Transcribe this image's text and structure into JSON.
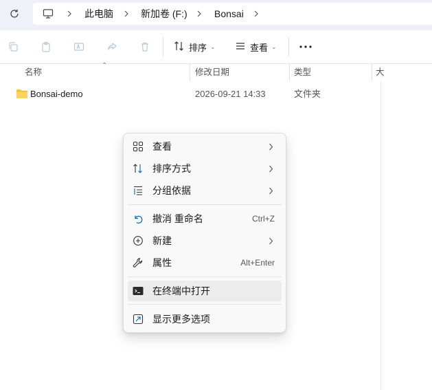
{
  "breadcrumb": {
    "items": [
      "此电脑",
      "新加卷 (F:)",
      "Bonsai"
    ]
  },
  "toolbar": {
    "sort_label": "排序",
    "view_label": "查看"
  },
  "columns": {
    "name": "名称",
    "modified": "修改日期",
    "type": "类型",
    "size": "大"
  },
  "files": [
    {
      "name": "Bonsai-demo",
      "modified": "2026-09-21 14:33",
      "type": "文件夹"
    }
  ],
  "context_menu": {
    "items": [
      {
        "label": "查看",
        "icon": "grid-view-icon",
        "submenu": true
      },
      {
        "label": "排序方式",
        "icon": "sort-icon",
        "submenu": true
      },
      {
        "label": "分组依据",
        "icon": "group-icon",
        "submenu": true
      },
      {
        "label": "撤消 重命名",
        "icon": "undo-icon",
        "shortcut": "Ctrl+Z"
      },
      {
        "label": "新建",
        "icon": "new-icon",
        "submenu": true
      },
      {
        "label": "属性",
        "icon": "wrench-icon",
        "shortcut": "Alt+Enter"
      },
      {
        "label": "在终端中打开",
        "icon": "terminal-icon",
        "highlighted": true
      },
      {
        "label": "显示更多选项",
        "icon": "show-more-icon"
      }
    ]
  },
  "colors": {
    "accent": "#0067c0",
    "folder": "#f4c33c"
  }
}
